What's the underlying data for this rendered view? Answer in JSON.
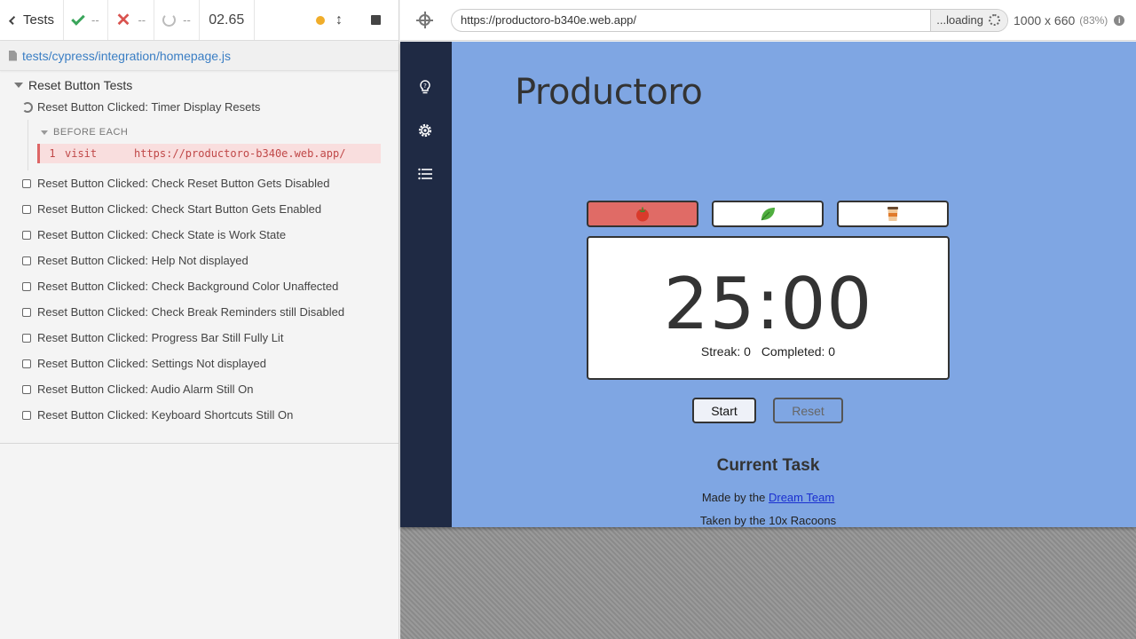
{
  "reporter": {
    "tests_label": "Tests",
    "passed": "--",
    "failed": "--",
    "pending": "--",
    "duration": "02.65",
    "spec_path": "tests/cypress/integration/homepage.js",
    "suite_title": "Reset Button Tests",
    "running_test": "Reset Button Clicked: Timer Display Resets",
    "hook_title": "BEFORE EACH",
    "command": {
      "number": "1",
      "name": "visit",
      "arg": "https://productoro-b340e.web.app/"
    },
    "tests": [
      "Reset Button Clicked: Check Reset Button Gets Disabled",
      "Reset Button Clicked: Check Start Button Gets Enabled",
      "Reset Button Clicked: Check State is Work State",
      "Reset Button Clicked: Help Not displayed",
      "Reset Button Clicked: Check Background Color Unaffected",
      "Reset Button Clicked: Check Break Reminders still Disabled",
      "Reset Button Clicked: Progress Bar Still Fully Lit",
      "Reset Button Clicked: Settings Not displayed",
      "Reset Button Clicked: Audio Alarm Still On",
      "Reset Button Clicked: Keyboard Shortcuts Still On"
    ]
  },
  "aut_header": {
    "url": "https://productoro-b340e.web.app/",
    "loading": "...loading",
    "viewport_size": "1000 x 660",
    "viewport_scale": "(83%)"
  },
  "app": {
    "title": "Productoro",
    "modes": [
      "tomato-icon",
      "leaf-icon",
      "coffee-icon"
    ],
    "timer": "25:00",
    "streak_label": "Streak: 0",
    "completed_label": "Completed: 0",
    "start_label": "Start",
    "reset_label": "Reset",
    "task_heading": "Current Task",
    "made_by_prefix": "Made by the",
    "made_by_link": "Dream Team",
    "taken_by": "Taken by the 10x Racoons",
    "colors": {
      "background": "#7fa6e3",
      "nav": "#1f2a44",
      "active_mode": "#e06b66"
    }
  }
}
